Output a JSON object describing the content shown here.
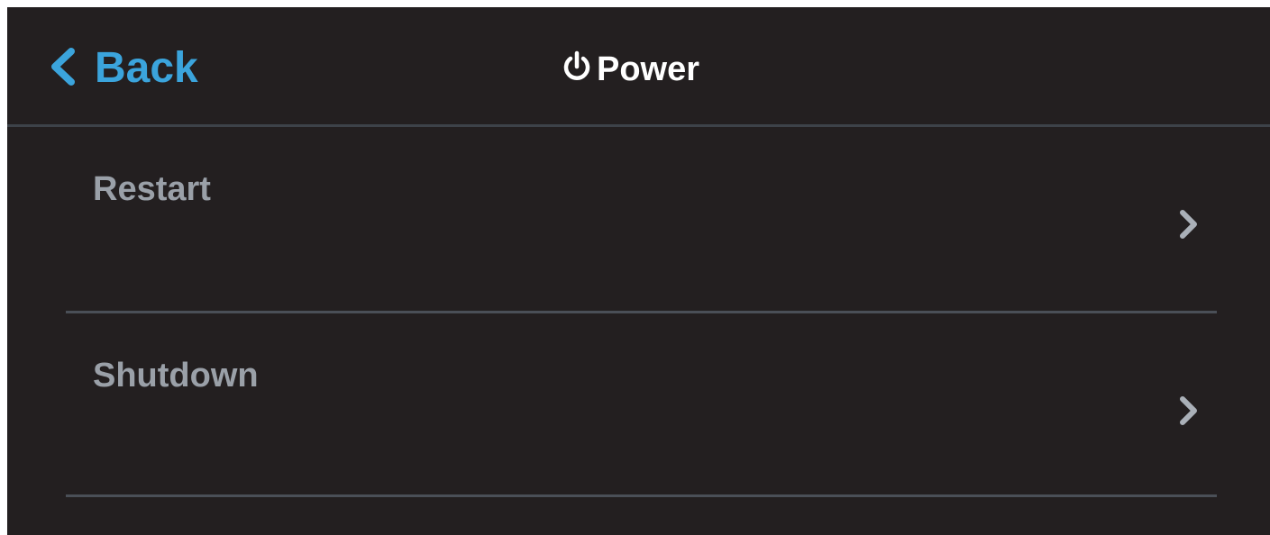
{
  "header": {
    "back_label": "Back",
    "title": "Power",
    "title_icon": "power-icon",
    "back_icon": "chevron-left-icon"
  },
  "menu": {
    "items": [
      {
        "label": "Restart",
        "icon": "chevron-right-icon"
      },
      {
        "label": "Shutdown",
        "icon": "chevron-right-icon"
      }
    ]
  },
  "colors": {
    "background": "#231f20",
    "accent": "#3ba4dc",
    "title_text": "#ffffff",
    "item_text": "#9aa0a8",
    "divider": "#4a4f57"
  }
}
